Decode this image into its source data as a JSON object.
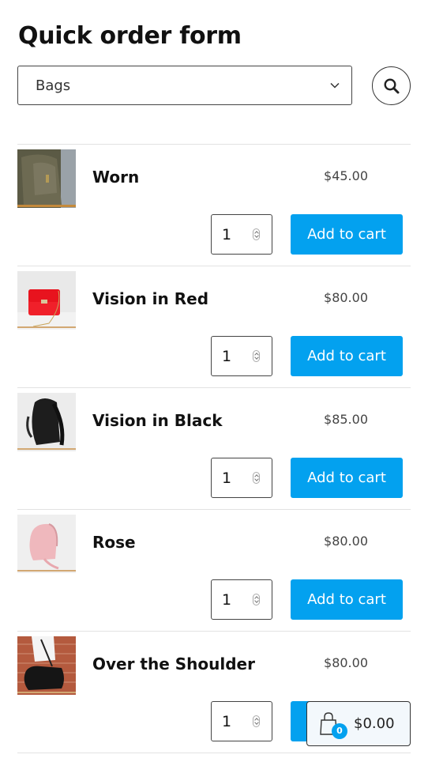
{
  "page": {
    "title": "Quick order form"
  },
  "filter": {
    "category_selected": "Bags",
    "search_icon": "search-icon",
    "dropdown_icon": "chevron-down-icon"
  },
  "products": [
    {
      "name": "Worn",
      "price": "$45.00",
      "quantity": "1",
      "button_label": "Add to cart",
      "image": "olive-canvas-backpack"
    },
    {
      "name": "Vision in Red",
      "price": "$80.00",
      "quantity": "1",
      "button_label": "Add to cart",
      "image": "red-chain-handbag"
    },
    {
      "name": "Vision in Black",
      "price": "$85.00",
      "quantity": "1",
      "button_label": "Add to cart",
      "image": "black-leather-backpack"
    },
    {
      "name": "Rose",
      "price": "$80.00",
      "quantity": "1",
      "button_label": "Add to cart",
      "image": "pink-saddle-bag"
    },
    {
      "name": "Over the Shoulder",
      "price": "$80.00",
      "quantity": "1",
      "button_label": "Add to cart",
      "image": "black-shoulder-bag"
    }
  ],
  "mini_cart": {
    "icon": "shopping-bag-icon",
    "count": "0",
    "total": "$0.00"
  },
  "colors": {
    "accent": "#03a1ef",
    "divider": "#e2e2e2"
  }
}
